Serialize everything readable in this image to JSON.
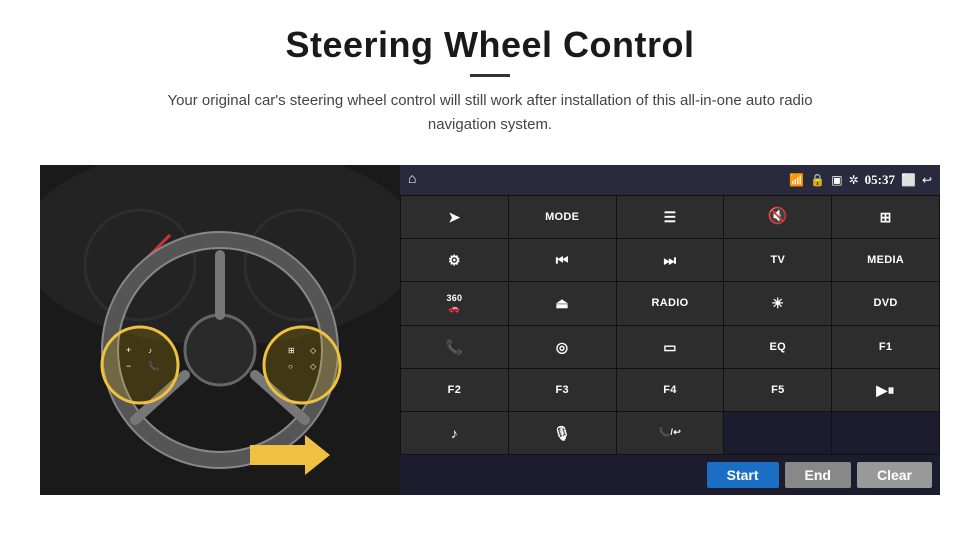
{
  "title": "Steering Wheel Control",
  "subtitle": "Your original car's steering wheel control will still work after installation of this all-in-one auto radio navigation system.",
  "status_bar": {
    "time": "05:37",
    "icons": [
      "wifi",
      "lock",
      "sim",
      "bluetooth",
      "mirror",
      "back"
    ]
  },
  "grid_buttons": [
    {
      "id": "b1",
      "type": "icon",
      "content": "navigate",
      "symbol": "➤"
    },
    {
      "id": "b2",
      "type": "text",
      "content": "MODE"
    },
    {
      "id": "b3",
      "type": "icon",
      "content": "list",
      "symbol": "☰"
    },
    {
      "id": "b4",
      "type": "icon",
      "content": "mute",
      "symbol": "🔇"
    },
    {
      "id": "b5",
      "type": "icon",
      "content": "apps",
      "symbol": "⊞"
    },
    {
      "id": "b6",
      "type": "icon",
      "content": "settings",
      "symbol": "⚙"
    },
    {
      "id": "b7",
      "type": "icon",
      "content": "prev",
      "symbol": "⏮"
    },
    {
      "id": "b8",
      "type": "icon",
      "content": "next",
      "symbol": "⏭"
    },
    {
      "id": "b9",
      "type": "text",
      "content": "TV"
    },
    {
      "id": "b10",
      "type": "text",
      "content": "MEDIA"
    },
    {
      "id": "b11",
      "type": "icon",
      "content": "360cam",
      "symbol": "360"
    },
    {
      "id": "b12",
      "type": "icon",
      "content": "eject",
      "symbol": "⏏"
    },
    {
      "id": "b13",
      "type": "text",
      "content": "RADIO"
    },
    {
      "id": "b14",
      "type": "icon",
      "content": "brightness",
      "symbol": "☀"
    },
    {
      "id": "b15",
      "type": "text",
      "content": "DVD"
    },
    {
      "id": "b16",
      "type": "icon",
      "content": "phone",
      "symbol": "📞"
    },
    {
      "id": "b17",
      "type": "icon",
      "content": "swirl",
      "symbol": "◎"
    },
    {
      "id": "b18",
      "type": "icon",
      "content": "display",
      "symbol": "▭"
    },
    {
      "id": "b19",
      "type": "text",
      "content": "EQ"
    },
    {
      "id": "b20",
      "type": "text",
      "content": "F1"
    },
    {
      "id": "b21",
      "type": "text",
      "content": "F2"
    },
    {
      "id": "b22",
      "type": "text",
      "content": "F3"
    },
    {
      "id": "b23",
      "type": "text",
      "content": "F4"
    },
    {
      "id": "b24",
      "type": "text",
      "content": "F5"
    },
    {
      "id": "b25",
      "type": "icon",
      "content": "playpause",
      "symbol": "▶⏸"
    },
    {
      "id": "b26",
      "type": "icon",
      "content": "music",
      "symbol": "♪"
    },
    {
      "id": "b27",
      "type": "icon",
      "content": "mic",
      "symbol": "🎤"
    },
    {
      "id": "b28",
      "type": "icon",
      "content": "answer",
      "symbol": "📞/↩"
    },
    {
      "id": "b29",
      "type": "empty",
      "content": ""
    },
    {
      "id": "b30",
      "type": "empty",
      "content": ""
    }
  ],
  "action_buttons": {
    "start": "Start",
    "end": "End",
    "clear": "Clear"
  }
}
